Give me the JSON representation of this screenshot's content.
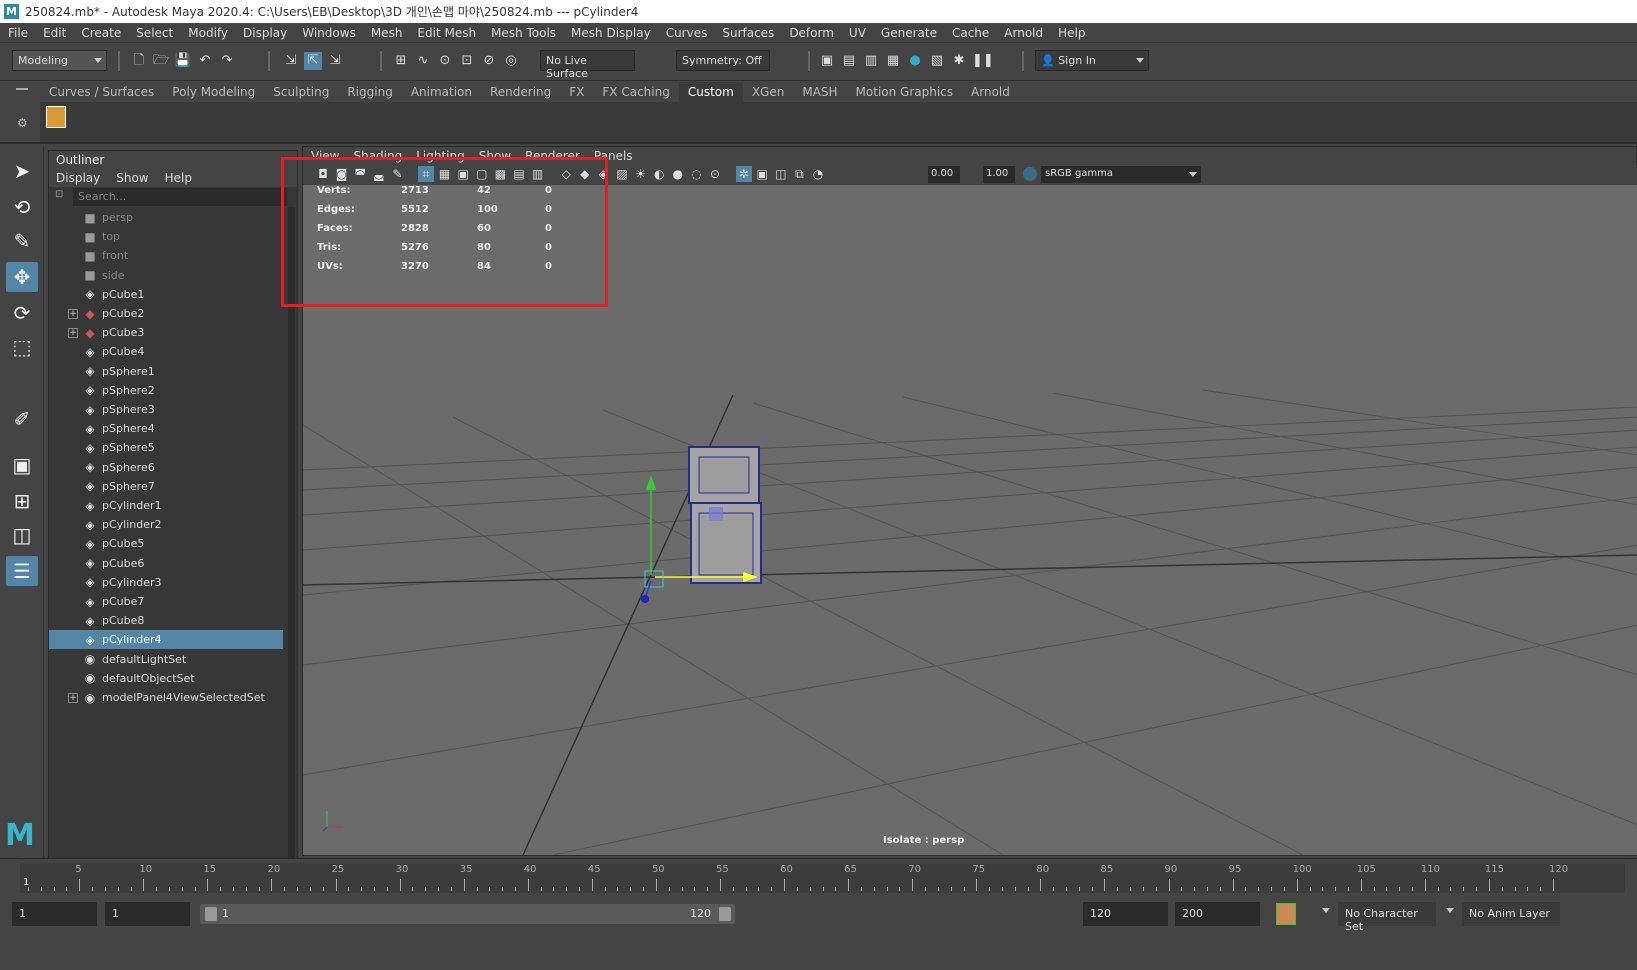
{
  "window": {
    "title": "250824.mb* - Autodesk Maya 2020.4: C:\\Users\\EB\\Desktop\\3D 개인\\손맵 마야\\250824.mb   ---   pCylinder4",
    "logo_letter": "M"
  },
  "menubar": [
    "File",
    "Edit",
    "Create",
    "Select",
    "Modify",
    "Display",
    "Windows",
    "Mesh",
    "Edit Mesh",
    "Mesh Tools",
    "Mesh Display",
    "Curves",
    "Surfaces",
    "Deform",
    "UV",
    "Generate",
    "Cache",
    "Arnold",
    "Help"
  ],
  "statusline": {
    "mode": "Modeling",
    "live_surface": "No Live Surface",
    "symmetry": "Symmetry: Off",
    "sign_in": "Sign In"
  },
  "shelf_tabs": [
    {
      "label": "Curves / Surfaces",
      "active": false
    },
    {
      "label": "Poly Modeling",
      "active": false
    },
    {
      "label": "Sculpting",
      "active": false
    },
    {
      "label": "Rigging",
      "active": false
    },
    {
      "label": "Animation",
      "active": false
    },
    {
      "label": "Rendering",
      "active": false
    },
    {
      "label": "FX",
      "active": false
    },
    {
      "label": "FX Caching",
      "active": false
    },
    {
      "label": "Custom",
      "active": true
    },
    {
      "label": "XGen",
      "active": false
    },
    {
      "label": "MASH",
      "active": false
    },
    {
      "label": "Motion Graphics",
      "active": false
    },
    {
      "label": "Arnold",
      "active": false
    }
  ],
  "outliner": {
    "title": "Outliner",
    "menu": [
      "Display",
      "Show",
      "Help"
    ],
    "search_placeholder": "Search...",
    "items": [
      {
        "label": "persp",
        "icon": "camera-icon",
        "dim": true,
        "expand": false,
        "selected": false
      },
      {
        "label": "top",
        "icon": "camera-icon",
        "dim": true,
        "expand": false,
        "selected": false
      },
      {
        "label": "front",
        "icon": "camera-icon",
        "dim": true,
        "expand": false,
        "selected": false
      },
      {
        "label": "side",
        "icon": "camera-icon",
        "dim": true,
        "expand": false,
        "selected": false
      },
      {
        "label": "pCube1",
        "icon": "mesh-icon",
        "dim": false,
        "expand": false,
        "selected": false
      },
      {
        "label": "pCube2",
        "icon": "group-icon",
        "dim": false,
        "expand": true,
        "selected": false
      },
      {
        "label": "pCube3",
        "icon": "group-icon",
        "dim": false,
        "expand": true,
        "selected": false
      },
      {
        "label": "pCube4",
        "icon": "mesh-icon",
        "dim": false,
        "expand": false,
        "selected": false
      },
      {
        "label": "pSphere1",
        "icon": "mesh-icon",
        "dim": false,
        "expand": false,
        "selected": false
      },
      {
        "label": "pSphere2",
        "icon": "mesh-icon",
        "dim": false,
        "expand": false,
        "selected": false
      },
      {
        "label": "pSphere3",
        "icon": "mesh-icon",
        "dim": false,
        "expand": false,
        "selected": false
      },
      {
        "label": "pSphere4",
        "icon": "mesh-icon",
        "dim": false,
        "expand": false,
        "selected": false
      },
      {
        "label": "pSphere5",
        "icon": "mesh-icon",
        "dim": false,
        "expand": false,
        "selected": false
      },
      {
        "label": "pSphere6",
        "icon": "mesh-icon",
        "dim": false,
        "expand": false,
        "selected": false
      },
      {
        "label": "pSphere7",
        "icon": "mesh-icon",
        "dim": false,
        "expand": false,
        "selected": false
      },
      {
        "label": "pCylinder1",
        "icon": "mesh-icon",
        "dim": false,
        "expand": false,
        "selected": false
      },
      {
        "label": "pCylinder2",
        "icon": "mesh-icon",
        "dim": false,
        "expand": false,
        "selected": false
      },
      {
        "label": "pCube5",
        "icon": "mesh-icon",
        "dim": false,
        "expand": false,
        "selected": false
      },
      {
        "label": "pCube6",
        "icon": "mesh-icon",
        "dim": false,
        "expand": false,
        "selected": false
      },
      {
        "label": "pCylinder3",
        "icon": "mesh-icon",
        "dim": false,
        "expand": false,
        "selected": false
      },
      {
        "label": "pCube7",
        "icon": "mesh-icon",
        "dim": false,
        "expand": false,
        "selected": false
      },
      {
        "label": "pCube8",
        "icon": "mesh-icon",
        "dim": false,
        "expand": false,
        "selected": false
      },
      {
        "label": "pCylinder4",
        "icon": "mesh-icon",
        "dim": false,
        "expand": false,
        "selected": true
      },
      {
        "label": "defaultLightSet",
        "icon": "set-icon",
        "dim": false,
        "expand": false,
        "selected": false
      },
      {
        "label": "defaultObjectSet",
        "icon": "set-icon",
        "dim": false,
        "expand": false,
        "selected": false
      },
      {
        "label": "modelPanel4ViewSelectedSet",
        "icon": "set-icon",
        "dim": false,
        "expand": true,
        "selected": false
      }
    ]
  },
  "viewport": {
    "menu": [
      "View",
      "Shading",
      "Lighting",
      "Show",
      "Renderer",
      "Panels"
    ],
    "exposure": "0.00",
    "gamma": "1.00",
    "color_space": "sRGB gamma",
    "label": "Isolate : persp",
    "hud": [
      {
        "name": "Verts:",
        "a": "2713",
        "b": "42",
        "c": "0"
      },
      {
        "name": "Edges:",
        "a": "5512",
        "b": "100",
        "c": "0"
      },
      {
        "name": "Faces:",
        "a": "2828",
        "b": "60",
        "c": "0"
      },
      {
        "name": "Tris:",
        "a": "5276",
        "b": "80",
        "c": "0"
      },
      {
        "name": "UVs:",
        "a": "3270",
        "b": "84",
        "c": "0"
      }
    ]
  },
  "timeline": {
    "ticks": [
      "5",
      "10",
      "15",
      "20",
      "25",
      "30",
      "35",
      "40",
      "45",
      "50",
      "55",
      "60",
      "65",
      "70",
      "75",
      "80",
      "85",
      "90",
      "95",
      "100",
      "105",
      "110",
      "115",
      "120"
    ],
    "current": "1"
  },
  "range": {
    "start": "1",
    "playback_start": "1",
    "slider_start": "1",
    "slider_end": "120",
    "playback_end": "120",
    "end": "200",
    "character_set": "No Character Set",
    "anim_layer": "No Anim Layer"
  },
  "colors": {
    "selection": "#5285a6",
    "highlight": "#e51e25",
    "viewport_bg": "#6b6b6b"
  }
}
